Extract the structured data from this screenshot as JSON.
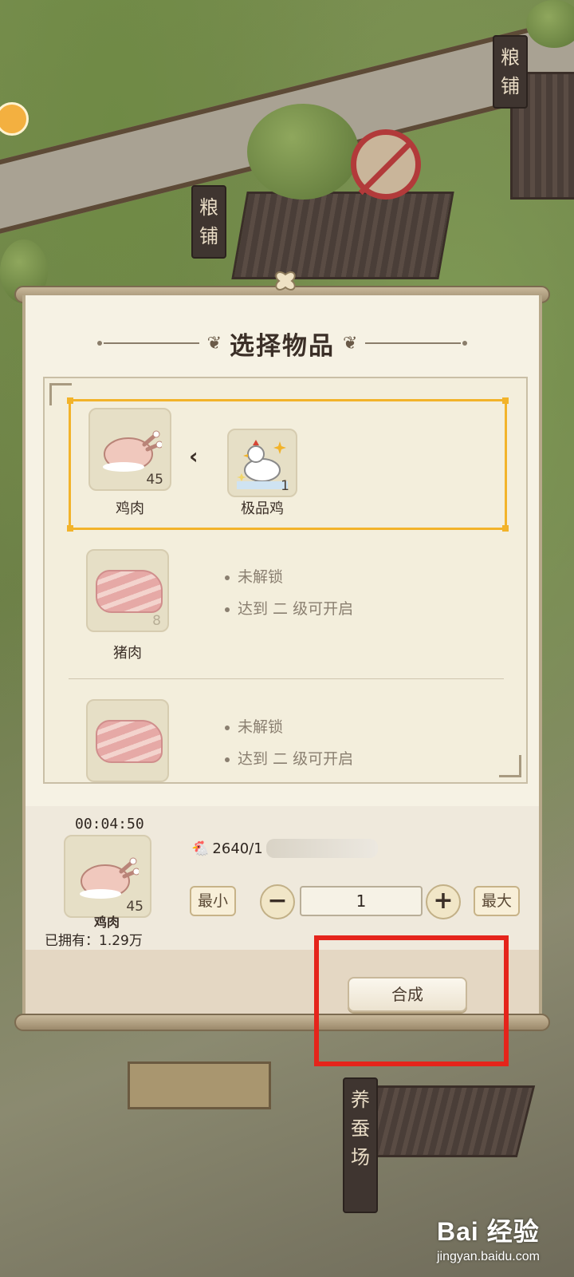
{
  "background": {
    "signs": [
      "粮",
      "铺",
      "养",
      "蚕",
      "场"
    ]
  },
  "dialog": {
    "title": "选择物品",
    "recipes": [
      {
        "ingredient": {
          "name": "鸡肉",
          "count": "45"
        },
        "result": {
          "name": "极品鸡",
          "count": "1"
        },
        "selected": true
      },
      {
        "ingredient": {
          "name": "猪肉",
          "count": "8"
        },
        "locked": true,
        "lock_lines": [
          "未解锁",
          "达到 二 级可开启"
        ]
      },
      {
        "ingredient": {
          "name": "",
          "count": ""
        },
        "locked": true,
        "lock_lines": [
          "未解锁",
          "达到 二 级可开启"
        ]
      }
    ],
    "craft": {
      "timer": "00:04:50",
      "item_name": "鸡肉",
      "item_count": "45",
      "owned_label": "已拥有：1.29万",
      "cost_text": "2640/1",
      "min_label": "最小",
      "max_label": "最大",
      "minus_label": "−",
      "plus_label": "+",
      "quantity": "1",
      "synthesize_label": "合成"
    }
  },
  "watermark": {
    "brand": "Bai 经验",
    "url": "jingyan.baidu.com"
  },
  "colors": {
    "selected_border": "#f2b32a",
    "highlight_box": "#e5241b"
  }
}
